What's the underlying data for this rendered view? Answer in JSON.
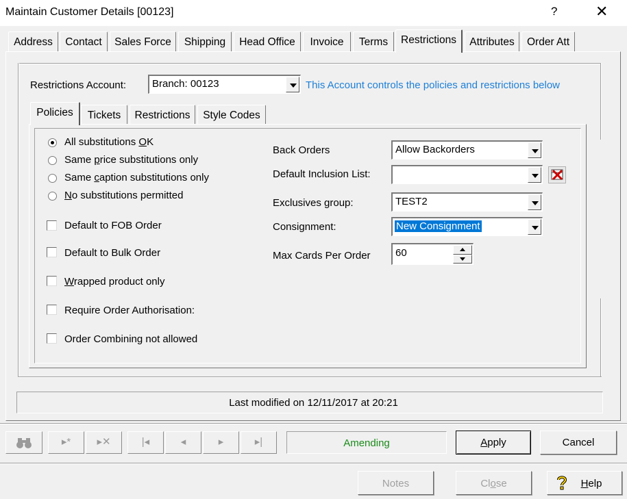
{
  "window": {
    "title": "Maintain Customer Details [00123]",
    "help_glyph": "?",
    "close_glyph": "✕"
  },
  "tabs": [
    {
      "label": "Address"
    },
    {
      "label": "Contact"
    },
    {
      "label": "Sales Force"
    },
    {
      "label": "Shipping"
    },
    {
      "label": "Head Office"
    },
    {
      "label": "Invoice"
    },
    {
      "label": "Terms"
    },
    {
      "label": "Restrictions",
      "active": true
    },
    {
      "label": "Attributes"
    },
    {
      "label": "Order Att"
    }
  ],
  "restrictions_account": {
    "label": "Restrictions Account:",
    "value": "Branch: 00123",
    "note": "This Account controls the policies and restrictions below",
    "note_color": "#1c7fd8"
  },
  "subtabs": [
    {
      "label": "Policies",
      "active": true
    },
    {
      "label": "Tickets"
    },
    {
      "label": "Restrictions"
    },
    {
      "label": "Style Codes"
    }
  ],
  "substitutions": [
    {
      "pre": "All substitutions ",
      "u": "O",
      "post": "K",
      "checked": true
    },
    {
      "pre": "Same ",
      "u": "p",
      "post": "rice substitutions only",
      "checked": false
    },
    {
      "pre": "Same ",
      "u": "c",
      "post": "aption substitutions only",
      "checked": false
    },
    {
      "pre": "",
      "u": "N",
      "post": "o substitutions permitted",
      "checked": false
    }
  ],
  "checkboxes": [
    {
      "pre": "Default to FOB Order",
      "u": "",
      "post": "",
      "checked": false
    },
    {
      "pre": "Default to Bulk Order",
      "u": "",
      "post": "",
      "checked": false
    },
    {
      "pre": "",
      "u": "W",
      "post": "rapped product only",
      "checked": false
    },
    {
      "pre": "Require Order Authorisation:",
      "u": "",
      "post": "",
      "checked": false
    },
    {
      "pre": "Order Combining not allowed",
      "u": "",
      "post": "",
      "checked": false
    }
  ],
  "fields": {
    "back_orders": {
      "label": "Back Orders",
      "value": "Allow Backorders"
    },
    "default_inclusion_list": {
      "label": "Default Inclusion List:",
      "value": ""
    },
    "exclusives_group": {
      "label": "Exclusives group:",
      "value": "TEST2"
    },
    "consignment": {
      "label": "Consignment:",
      "value": "New Consignment"
    },
    "max_cards": {
      "label": "Max Cards Per Order",
      "value": "60"
    }
  },
  "status": {
    "last_modified": "Last modified on 12/11/2017 at 20:21",
    "mode": "Amending",
    "mode_color": "#1a8a1a"
  },
  "nav": {
    "find": "⌕",
    "new": "▸*",
    "delete": "▸✕",
    "first": "|◂",
    "prev": "◂",
    "next": "▸",
    "last": "▸|"
  },
  "buttons": {
    "apply_u": "A",
    "apply_rest": "pply",
    "cancel": "Cancel",
    "notes": "Notes",
    "close_pre": "Cl",
    "close_u": "o",
    "close_post": "se",
    "help_u": "H",
    "help_rest": "elp"
  },
  "colors": {
    "accent_selection": "#0078d7",
    "clear_icon_red": "#cc0000"
  }
}
